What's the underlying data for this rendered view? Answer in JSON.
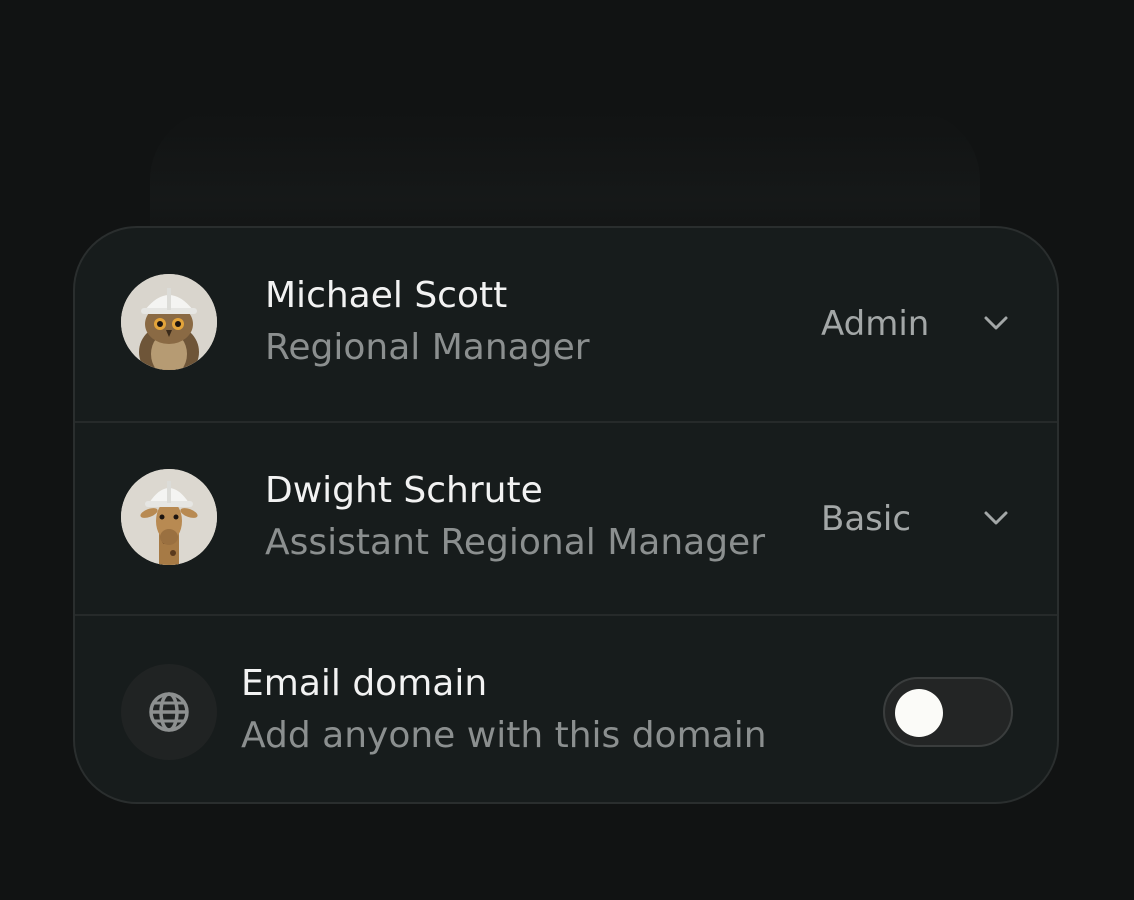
{
  "members": [
    {
      "name": "Michael Scott",
      "title": "Regional Manager",
      "role": "Admin",
      "avatar_icon": "owl-hardhat-avatar"
    },
    {
      "name": "Dwight Schrute",
      "title": "Assistant Regional Manager",
      "role": "Basic",
      "avatar_icon": "giraffe-hardhat-avatar"
    }
  ],
  "email_domain": {
    "label": "Email domain",
    "description": "Add anyone with this domain",
    "icon": "globe-icon",
    "enabled": false
  },
  "colors": {
    "background": "#111313",
    "card": "#171c1c",
    "primary_text": "#f2f2f2",
    "secondary_text": "#8b8f8f"
  }
}
